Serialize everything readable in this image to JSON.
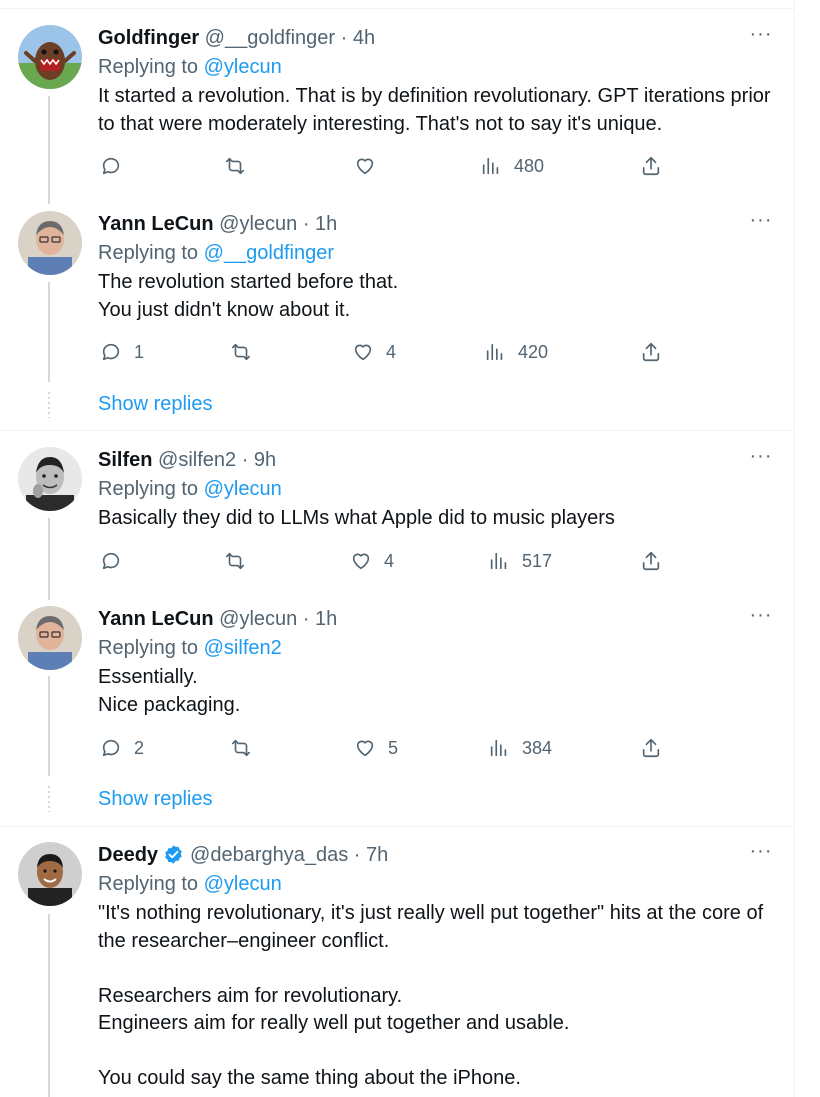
{
  "colors": {
    "link": "#1d9bf0",
    "muted": "#536471",
    "text": "#0f1419",
    "thread_line": "#cfd9de"
  },
  "tweets": [
    {
      "name": "Goldfinger",
      "handle": "@__goldfinger",
      "time": "· 4h",
      "replying_label": "Replying to",
      "replying_to": "@ylecun",
      "text": "It started a revolution. That is by definition revolutionary. GPT iterations prior to that were moderately interesting. That's not to say it's unique.",
      "replies": "",
      "likes": "",
      "views": "480",
      "more_label": "···"
    },
    {
      "name": "Yann LeCun",
      "handle": "@ylecun",
      "time": "· 1h",
      "replying_label": "Replying to",
      "replying_to": "@__goldfinger",
      "text": "The revolution started before that.\nYou just didn't know about it.",
      "replies": "1",
      "likes": "4",
      "views": "420",
      "more_label": "···"
    },
    {
      "name": "Silfen",
      "handle": "@silfen2",
      "time": "· 9h",
      "replying_label": "Replying to",
      "replying_to": "@ylecun",
      "text": "Basically they did to LLMs what Apple did to music players",
      "replies": "",
      "likes": "4",
      "views": "517",
      "more_label": "···"
    },
    {
      "name": "Yann LeCun",
      "handle": "@ylecun",
      "time": "· 1h",
      "replying_label": "Replying to",
      "replying_to": "@silfen2",
      "text": "Essentially.\nNice packaging.",
      "replies": "2",
      "likes": "5",
      "views": "384",
      "more_label": "···"
    },
    {
      "name": "Deedy",
      "handle": "@debarghya_das",
      "time": "· 7h",
      "replying_label": "Replying to",
      "replying_to": "@ylecun",
      "text": "\"It's nothing revolutionary, it's just really well put together\" hits at the core of the researcher–engineer conflict.\n\nResearchers aim for revolutionary.\nEngineers aim for really well put together and usable.\n\nYou could say the same thing about the iPhone.",
      "more_label": "···"
    }
  ],
  "show_replies_1": "Show replies",
  "show_replies_2": "Show replies"
}
